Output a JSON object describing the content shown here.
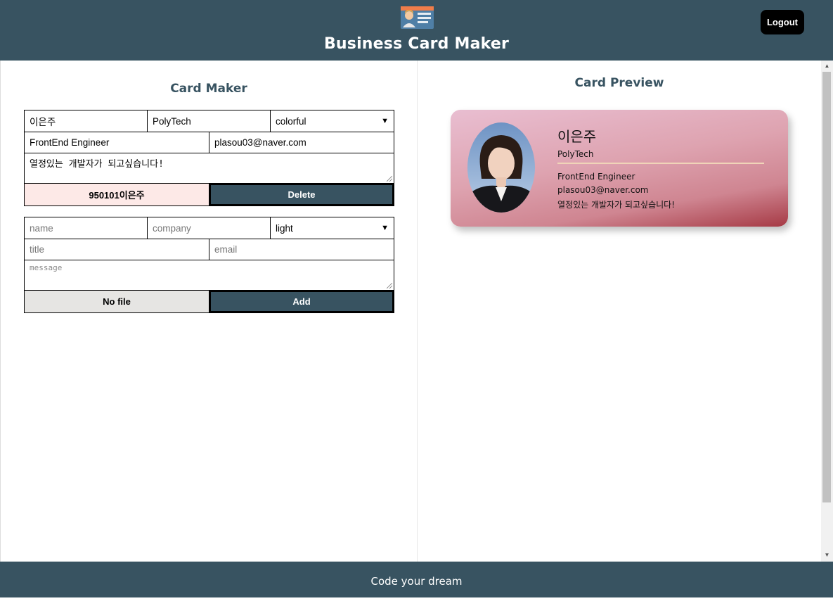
{
  "header": {
    "title": "Business Card Maker",
    "logout_label": "Logout",
    "logo_icon": "business-card-logo"
  },
  "maker": {
    "title": "Card Maker",
    "card_form": {
      "name": "이은주",
      "company": "PolyTech",
      "theme": "colorful",
      "title": "FrontEnd Engineer",
      "email": "plasou03@naver.com",
      "message": "열정있는 개발자가 되고싶습니다!",
      "file_label": "950101이은주",
      "delete_label": "Delete"
    },
    "add_form": {
      "name_placeholder": "name",
      "company_placeholder": "company",
      "theme": "light",
      "title_placeholder": "title",
      "email_placeholder": "email",
      "message_placeholder": "message",
      "file_label": "No file",
      "add_label": "Add"
    }
  },
  "preview": {
    "title": "Card Preview",
    "card": {
      "name": "이은주",
      "company": "PolyTech",
      "title": "FrontEnd Engineer",
      "email": "plasou03@naver.com",
      "message": "열정있는 개발자가 되고싶습니다!",
      "theme": "colorful"
    }
  },
  "footer": {
    "text": "Code your dream"
  },
  "colors": {
    "brand": "#385361",
    "file_button_pink": "#fde9e7",
    "file_button_grey": "#e6e5e3"
  }
}
